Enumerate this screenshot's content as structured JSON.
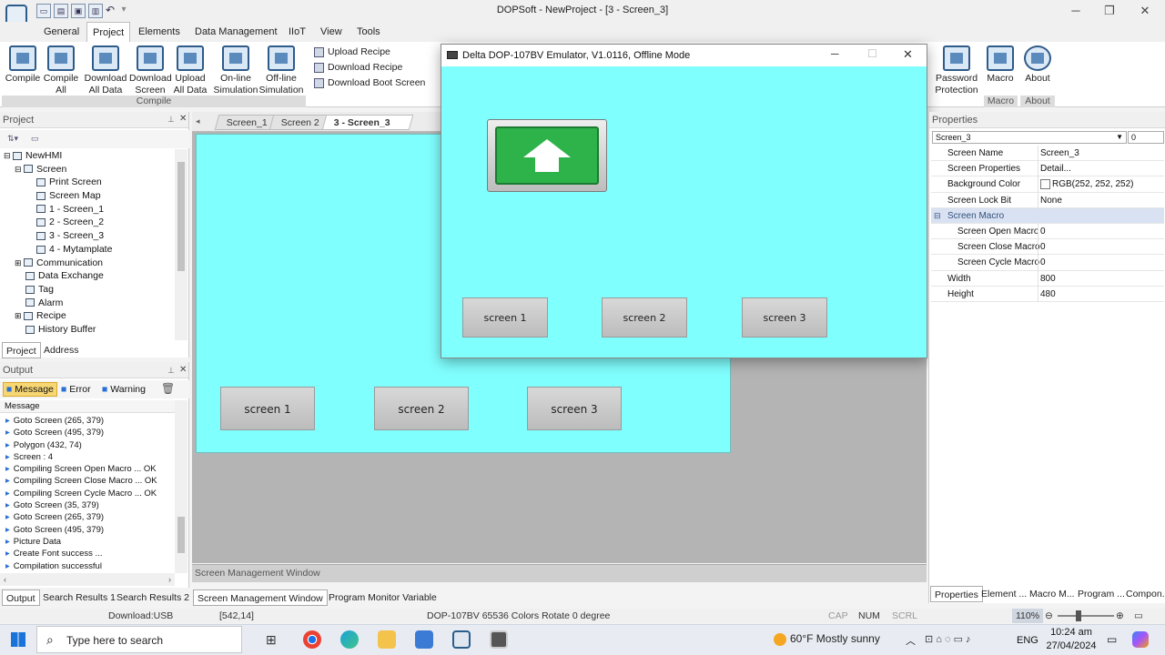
{
  "app": {
    "title": "DOPSoft - NewProject - [3 - Screen_3]"
  },
  "menu": [
    "General",
    "Project",
    "Elements",
    "Data Management",
    "IIoT",
    "View",
    "Tools"
  ],
  "ribbon": {
    "compile": "Compile",
    "compile_all": "Compile All",
    "download_all": "Download All Data",
    "download_screen": "Download Screen",
    "upload_all": "Upload All Data",
    "online_sim": "On-line Simulation",
    "offline_sim": "Off-line Simulation",
    "group_compile": "Compile",
    "upload_recipe": "Upload Recipe",
    "download_recipe": "Download Recipe",
    "download_boot": "Download Boot Screen",
    "password": "Password Protection",
    "macro": "Macro",
    "about": "About",
    "group_macro": "Macro",
    "group_about": "About"
  },
  "project_panel": {
    "title": "Project",
    "tree": [
      "NewHMI",
      "Screen",
      "Print Screen",
      "Screen Map",
      "1 - Screen_1",
      "2 - Screen_2",
      "3 - Screen_3",
      "4 - Mytamplate",
      "Communication",
      "Data Exchange",
      "Tag",
      "Alarm",
      "Recipe",
      "History Buffer"
    ],
    "tab_project": "Project",
    "tab_address": "Address"
  },
  "output_panel": {
    "title": "Output",
    "filter_message": "Message",
    "filter_error": "Error",
    "filter_warning": "Warning",
    "col_header": "Message",
    "messages": [
      "Goto Screen (265, 379)",
      "Goto Screen (495, 379)",
      "Polygon (432, 74)",
      "Screen : 4",
      "Compiling Screen Open Macro ... OK",
      "Compiling Screen Close Macro ... OK",
      "Compiling Screen Cycle Macro ... OK",
      "Goto Screen (35, 379)",
      "Goto Screen (265, 379)",
      "Goto Screen (495, 379)",
      "Picture Data",
      "Create Font success ...",
      "Compilation successful"
    ],
    "tabs": [
      "Output",
      "Search Results 1",
      "Search Results 2"
    ]
  },
  "doc_tabs": [
    "Screen_1",
    "Screen 2",
    "3 - Screen_3"
  ],
  "canvas": {
    "buttons": [
      "screen 1",
      "screen 2",
      "screen 3"
    ]
  },
  "emulator": {
    "title": "Delta DOP-107BV Emulator, V1.0116, Offline Mode",
    "buttons": [
      "screen 1",
      "screen 2",
      "screen 3"
    ]
  },
  "screen_mgmt": {
    "title": "Screen Management Window",
    "tabs": [
      "Screen Management Window",
      "Program Monitor Variable"
    ]
  },
  "properties": {
    "title": "Properties",
    "selector": "Screen_3",
    "selector_extra": "0",
    "rows": [
      {
        "k": "Screen Name",
        "v": "Screen_3"
      },
      {
        "k": "Screen Properties",
        "v": "Detail..."
      },
      {
        "k": "Background Color",
        "v": "RGB(252, 252, 252)"
      },
      {
        "k": "Screen Lock Bit",
        "v": "None"
      }
    ],
    "macro_group": "Screen Macro",
    "macro_rows": [
      {
        "k": "Screen Open Macro",
        "v": "0"
      },
      {
        "k": "Screen Close Macro",
        "v": "0"
      },
      {
        "k": "Screen Cycle Macro",
        "v": "0"
      }
    ],
    "size_rows": [
      {
        "k": "Width",
        "v": "800"
      },
      {
        "k": "Height",
        "v": "480"
      }
    ],
    "tabs": [
      "Properties",
      "Element ...",
      "Macro M...",
      "Program ...",
      "Compon..."
    ]
  },
  "status": {
    "download": "Download:USB",
    "coords": "[542,14]",
    "device": "DOP-107BV 65536 Colors Rotate 0 degree",
    "cap": "CAP",
    "num": "NUM",
    "scrl": "SCRL",
    "zoom": "110%"
  },
  "taskbar": {
    "search": "Type here to search",
    "weather": "60°F  Mostly sunny",
    "lang": "ENG",
    "time": "10:24 am",
    "date": "27/04/2024"
  },
  "colors": {
    "hmi_bg": "#80ffff",
    "green_button": "#2db34a",
    "accent": "#2a6fd6"
  }
}
